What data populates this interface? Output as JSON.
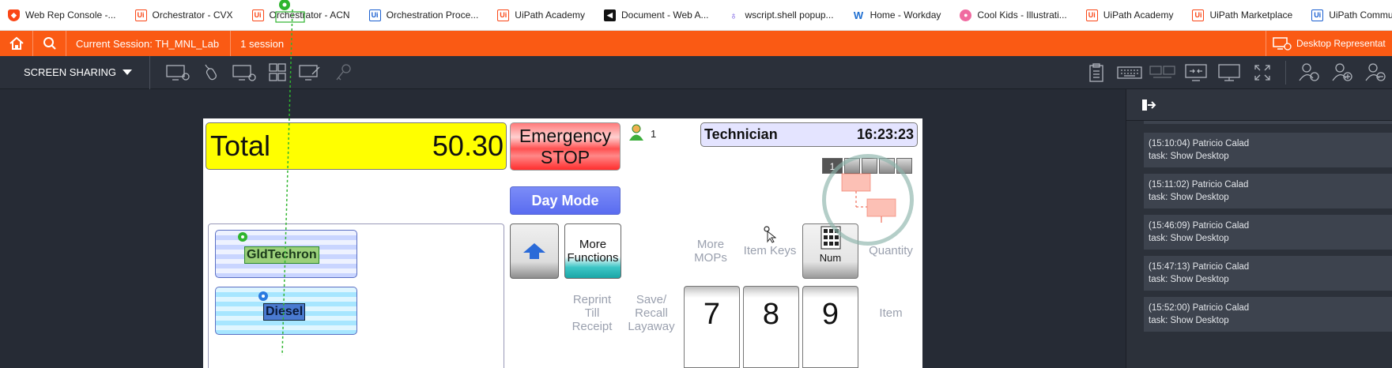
{
  "bookmarks": [
    {
      "label": "Web Rep Console -...",
      "icon": "shield-icon"
    },
    {
      "label": "Orchestrator - CVX",
      "icon": "uipath-icon"
    },
    {
      "label": "Orchestrator - ACN",
      "icon": "uipath-icon"
    },
    {
      "label": "Orchestration Proce...",
      "icon": "uipath-blue-icon"
    },
    {
      "label": "UiPath Academy",
      "icon": "uipath-icon"
    },
    {
      "label": "Document - Web A...",
      "icon": "document-icon"
    },
    {
      "label": "wscript.shell popup...",
      "icon": "bulb-icon"
    },
    {
      "label": "Home - Workday",
      "icon": "workday-icon"
    },
    {
      "label": "Cool Kids - Illustrati...",
      "icon": "cat-icon"
    },
    {
      "label": "UiPath Academy",
      "icon": "uipath-icon"
    },
    {
      "label": "UiPath Marketplace",
      "icon": "uipath-icon"
    },
    {
      "label": "UiPath Community...",
      "icon": "uipath-blue-icon"
    }
  ],
  "session": {
    "title": "Current Session: TH_MNL_Lab",
    "count": "1 session",
    "desktop_rep": "Desktop Representat"
  },
  "toolbar": {
    "screen_sharing": "SCREEN SHARING"
  },
  "pos": {
    "total_label": "Total",
    "total_value": "50.30",
    "emergency_line1": "Emergency",
    "emergency_line2": "STOP",
    "user_count": "1",
    "role": "Technician",
    "time": "16:23:23",
    "status_number": "1",
    "day_mode": "Day Mode",
    "more_functions_line1": "More",
    "more_functions_line2": "Functions",
    "more_mops_line1": "More",
    "more_mops_line2": "MOPs",
    "item_keys": "Item Keys",
    "num": "Num",
    "quantity": "Quantity",
    "reprint_line1": "Reprint",
    "reprint_line2": "Till",
    "reprint_line3": "Receipt",
    "save_line1": "Save/",
    "save_line2": "Recall",
    "save_line3": "Layaway",
    "key7": "7",
    "key8": "8",
    "key9": "9",
    "item": "Item",
    "items": [
      "GldTechron",
      "Diesel"
    ]
  },
  "log": [
    {
      "time": "(15:10:04) Patricio Calad",
      "task": "task: Show Desktop"
    },
    {
      "time": "(15:11:02) Patricio Calad",
      "task": "task: Show Desktop"
    },
    {
      "time": "(15:46:09) Patricio Calad",
      "task": "task: Show Desktop"
    },
    {
      "time": "(15:47:13) Patricio Calad",
      "task": "task: Show Desktop"
    },
    {
      "time": "(15:52:00) Patricio Calad",
      "task": "task: Show Desktop"
    }
  ],
  "colors": {
    "accent": "#fa5a14",
    "total_bg": "#ffff00",
    "day_mode": "#6677f3"
  }
}
